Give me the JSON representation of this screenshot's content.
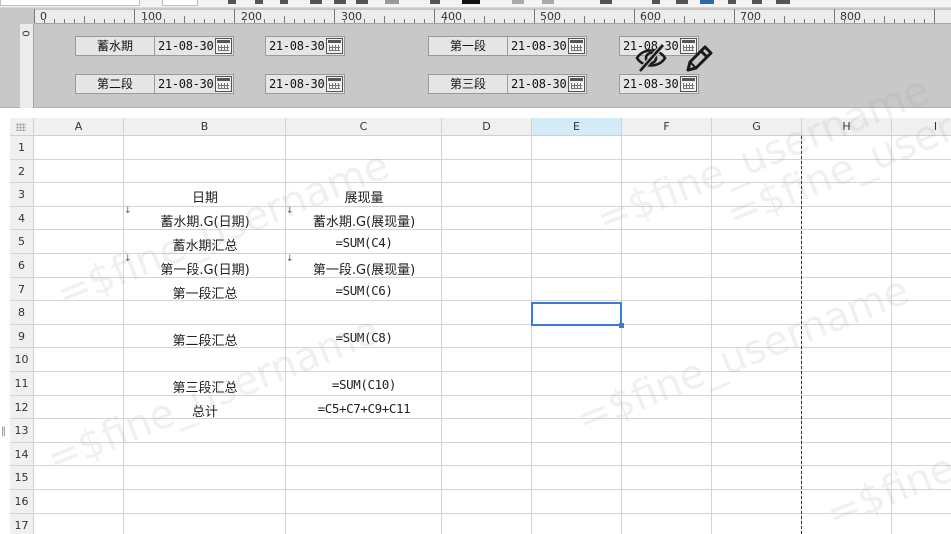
{
  "ruler": {
    "top_marks": [
      "0",
      "100",
      "200",
      "300",
      "400",
      "500",
      "600",
      "700",
      "800"
    ],
    "left_mark": "0"
  },
  "parameters": {
    "row1": [
      {
        "label": "蓄水期",
        "date_start": "21-08-30",
        "date_end": "21-08-30"
      },
      {
        "label": "第一段",
        "date_start": "21-08-30",
        "date_end": "21-08-30"
      }
    ],
    "row2": [
      {
        "label": "第二段",
        "date_start": "21-08-30",
        "date_end": "21-08-30"
      },
      {
        "label": "第三段",
        "date_start": "21-08-30",
        "date_end": "21-08-30"
      }
    ]
  },
  "icons": {
    "calendar": "calendar-icon",
    "visibility_off": "eye-slash-icon",
    "edit": "pencil-icon"
  },
  "sheet": {
    "columns": [
      "A",
      "B",
      "C",
      "D",
      "E",
      "F",
      "G",
      "H",
      "I"
    ],
    "active_column": "E",
    "rows": [
      "1",
      "2",
      "3",
      "4",
      "5",
      "6",
      "7",
      "8",
      "9",
      "10",
      "11",
      "12",
      "13",
      "14",
      "15",
      "16",
      "17"
    ],
    "active_cell": "E8",
    "cells": {
      "B3": "日期",
      "C3": "展现量",
      "B4": "蓄水期.G(日期)",
      "C4": "蓄水期.G(展现量)",
      "B5": "蓄水期汇总",
      "C5": "=SUM(C4)",
      "B6": "第一段.G(日期)",
      "C6": "第一段.G(展现量)",
      "B7": "第一段汇总",
      "C7": "=SUM(C6)",
      "B9": "第二段汇总",
      "C9": "=SUM(C8)",
      "B11": "第三段汇总",
      "C11": "=SUM(C10)",
      "B12": "总计",
      "C12": "=C5+C7+C9+C11"
    },
    "expand_marker": "↓"
  },
  "watermark": {
    "text": "=$fine_username"
  },
  "colors": {
    "panel_bg": "#c8c8c8",
    "selection": "#3a7bd5",
    "active_header": "#d4ecf8"
  }
}
